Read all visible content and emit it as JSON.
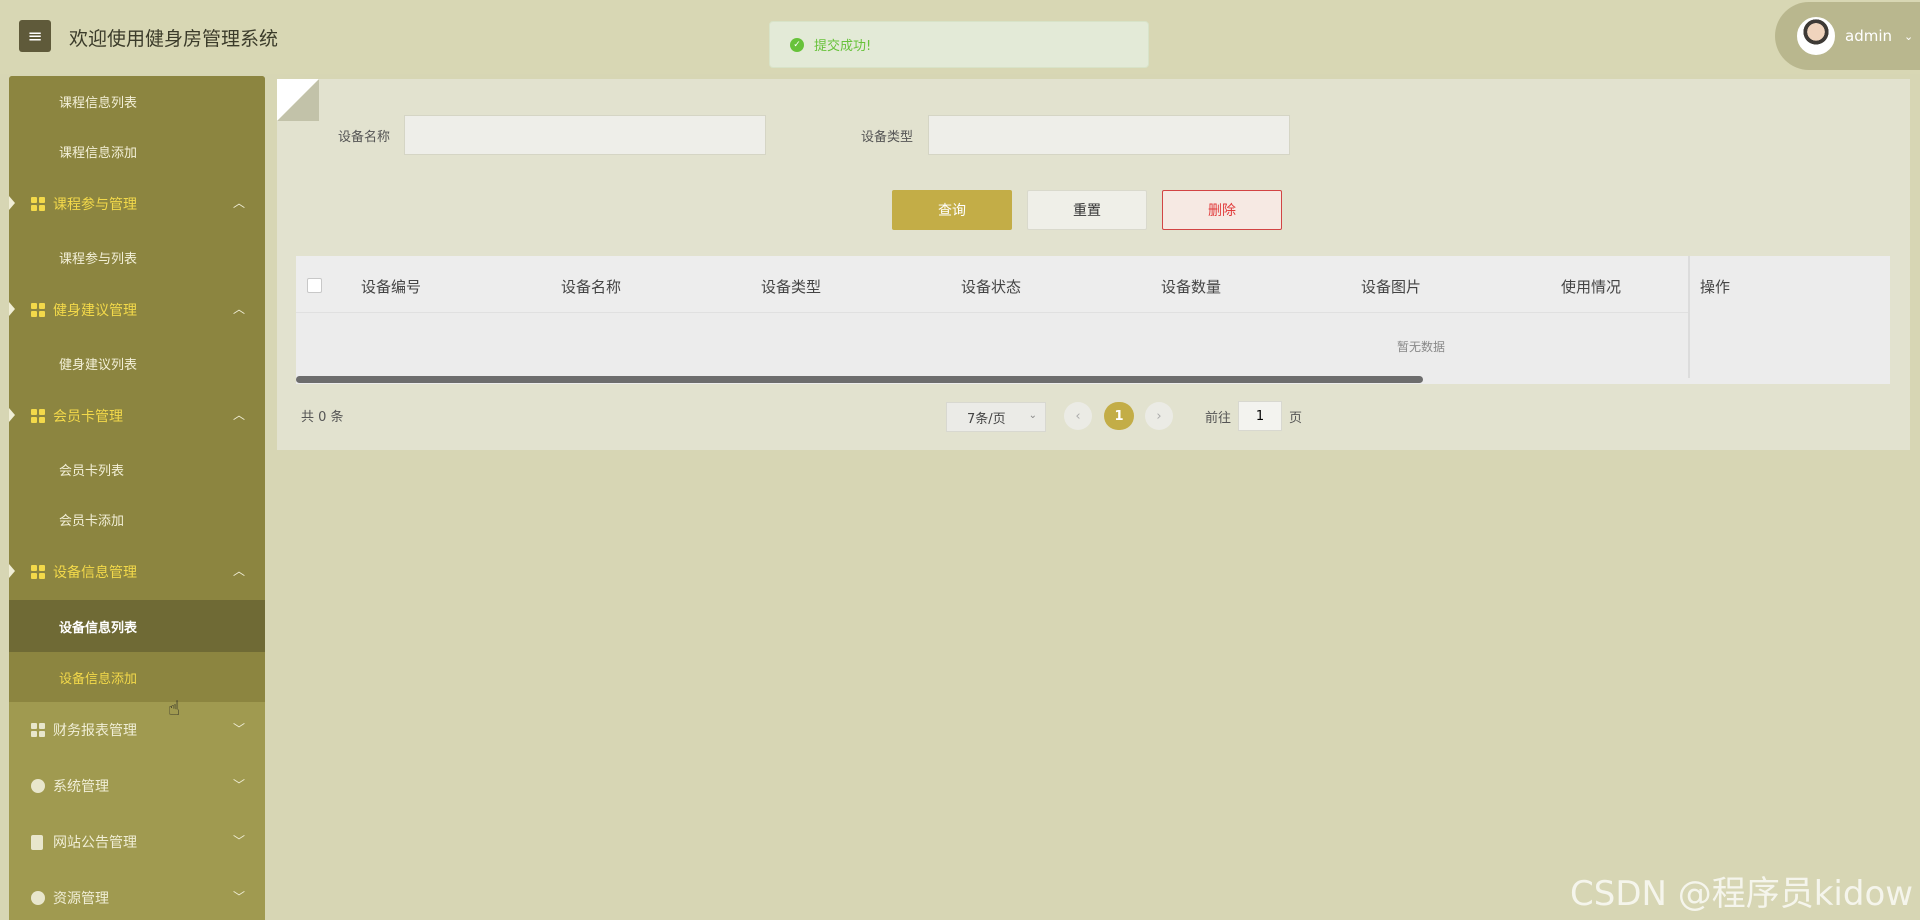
{
  "header": {
    "menu_icon": "hamburger-icon",
    "title": "欢迎使用健身房管理系统",
    "toast": "提交成功!",
    "user": "admin"
  },
  "sidebar": {
    "items": [
      {
        "type": "sub",
        "label": "课程信息列表"
      },
      {
        "type": "sub",
        "label": "课程信息添加"
      },
      {
        "type": "group",
        "label": "课程参与管理",
        "expanded": true
      },
      {
        "type": "sub",
        "label": "课程参与列表"
      },
      {
        "type": "group",
        "label": "健身建议管理",
        "expanded": true
      },
      {
        "type": "sub",
        "label": "健身建议列表"
      },
      {
        "type": "group",
        "label": "会员卡管理",
        "expanded": true
      },
      {
        "type": "sub",
        "label": "会员卡列表"
      },
      {
        "type": "sub",
        "label": "会员卡添加"
      },
      {
        "type": "group",
        "label": "设备信息管理",
        "expanded": true
      },
      {
        "type": "sub",
        "label": "设备信息列表",
        "active": true
      },
      {
        "type": "sub",
        "label": "设备信息添加",
        "highlight": true
      },
      {
        "type": "group",
        "label": "财务报表管理",
        "expanded": false
      },
      {
        "type": "group",
        "label": "系统管理",
        "expanded": false
      },
      {
        "type": "group",
        "label": "网站公告管理",
        "expanded": false
      },
      {
        "type": "group",
        "label": "资源管理",
        "expanded": false
      }
    ]
  },
  "search": {
    "name_label": "设备名称",
    "name_value": "",
    "type_label": "设备类型",
    "type_value": ""
  },
  "buttons": {
    "query": "查询",
    "reset": "重置",
    "delete": "删除"
  },
  "table": {
    "headers": [
      "设备编号",
      "设备名称",
      "设备类型",
      "设备状态",
      "设备数量",
      "设备图片",
      "使用情况"
    ],
    "action_header": "操作",
    "empty": "暂无数据"
  },
  "pagination": {
    "total": "共 0 条",
    "page_size": "7条/页",
    "current": "1",
    "goto_prefix": "前往",
    "goto_value": "1",
    "goto_suffix": "页"
  },
  "watermark": "CSDN @程序员kidow"
}
